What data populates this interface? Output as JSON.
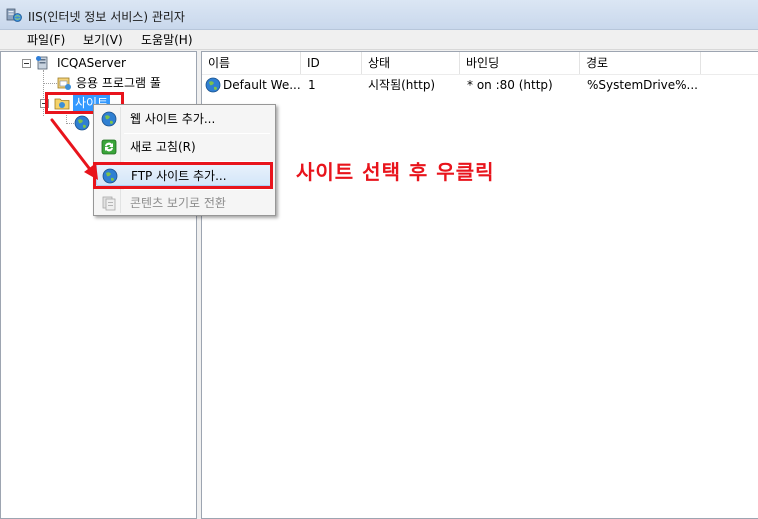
{
  "window": {
    "title": "IIS(인터넷 정보 서비스) 관리자"
  },
  "menu": {
    "items": [
      "파일(F)",
      "보기(V)",
      "도움말(H)"
    ]
  },
  "tree": {
    "server": "ICQAServer",
    "app_pools": "응용 프로그램 풀",
    "sites": "사이트"
  },
  "list": {
    "columns": [
      "이름",
      "ID",
      "상태",
      "바인딩",
      "경로"
    ],
    "rows": [
      {
        "name": "Default We...",
        "id": "1",
        "status": "시작됨(http)",
        "binding": "* on :80 (http)",
        "path": "%SystemDrive%..."
      }
    ]
  },
  "context_menu": {
    "items": [
      "웹 사이트 추가...",
      "새로 고침(R)",
      "FTP 사이트 추가...",
      "콘텐츠 보기로 전환"
    ]
  },
  "annotation": {
    "text": "사이트 선택 후 우클릭",
    "color": "#e8141c"
  },
  "colors": {
    "selection": "#3399ff",
    "menu_hover": "#d3e6fa"
  },
  "icons": {
    "app": "iis-manager-icon",
    "server": "server-icon",
    "app_pools": "application-pool-icon",
    "sites": "sites-folder-icon",
    "site": "globe-icon",
    "refresh": "refresh-icon",
    "content_view": "content-view-icon"
  }
}
